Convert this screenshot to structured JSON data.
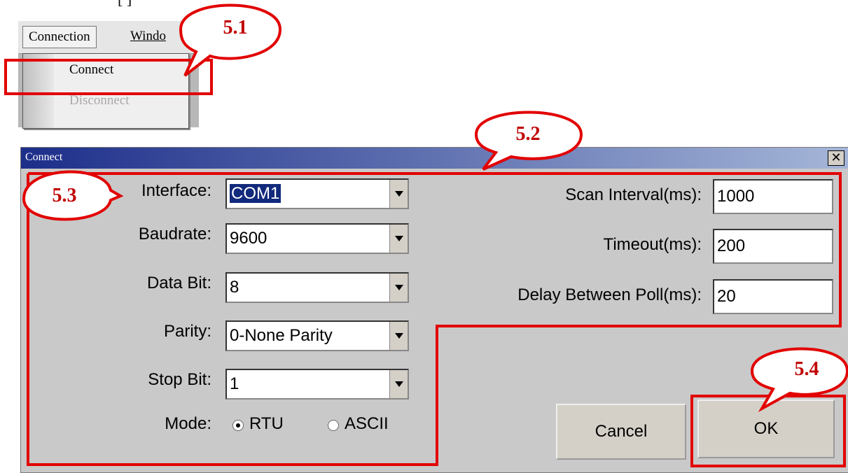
{
  "top_fragment": "[  ]",
  "menu": {
    "items": [
      "Connection",
      "Windo"
    ],
    "dropdown": [
      "Connect",
      "Disconnect"
    ]
  },
  "dialog": {
    "title": "Connect",
    "close": "✕",
    "fields": {
      "interface": {
        "label": "Interface:",
        "value": "COM1"
      },
      "baudrate": {
        "label": "Baudrate:",
        "value": "9600"
      },
      "data_bit": {
        "label": "Data Bit:",
        "value": "8"
      },
      "parity": {
        "label": "Parity:",
        "value": "0-None Parity"
      },
      "stop_bit": {
        "label": "Stop Bit:",
        "value": "1"
      }
    },
    "mode": {
      "label": "Mode:",
      "options": [
        "RTU",
        "ASCII"
      ],
      "selected": "RTU"
    },
    "right_fields": {
      "scan_interval": {
        "label": "Scan Interval(ms):",
        "value": "1000"
      },
      "timeout": {
        "label": "Timeout(ms):",
        "value": "200"
      },
      "delay": {
        "label": "Delay Between Poll(ms):",
        "value": "20"
      }
    },
    "buttons": {
      "cancel": "Cancel",
      "ok": "OK"
    }
  },
  "annotations": {
    "c51": "5.1",
    "c52": "5.2",
    "c53": "5.3",
    "c54": "5.4",
    "color": "#e20000"
  }
}
